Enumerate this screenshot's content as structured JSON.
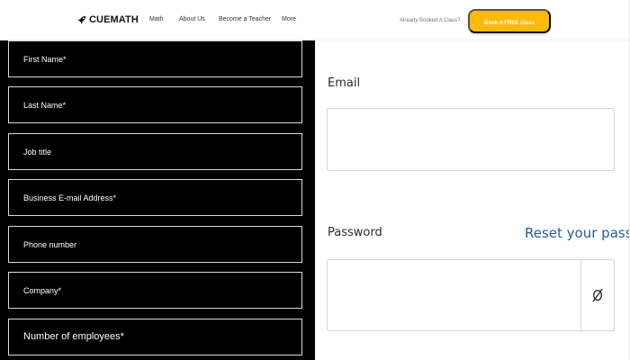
{
  "header": {
    "logo": {
      "icon": "rocket-icon",
      "text": "CUEMATH"
    },
    "nav": [
      {
        "label": "Math"
      },
      {
        "label": "About Us"
      },
      {
        "label": "Become a Teacher"
      },
      {
        "label": "More"
      }
    ],
    "already_booked_text": "Already Booked A Class?",
    "cta_label": "Book A FREE Class",
    "cta_color": "#ffba07"
  },
  "left_form": {
    "background": "#000000",
    "fields": [
      {
        "label": "First Name*"
      },
      {
        "label": "Last Name*"
      },
      {
        "label": "Job title"
      },
      {
        "label": "Business E-mail Address*"
      },
      {
        "label": "Phone number"
      },
      {
        "label": "Company*"
      },
      {
        "label": "Number of employees*"
      }
    ]
  },
  "right_form": {
    "email": {
      "label": "Email",
      "value": ""
    },
    "password": {
      "label": "Password",
      "value": "",
      "reset_link": "Reset your password?",
      "toggle_icon": "eye-slash-icon"
    },
    "link_color": "#275c99"
  }
}
